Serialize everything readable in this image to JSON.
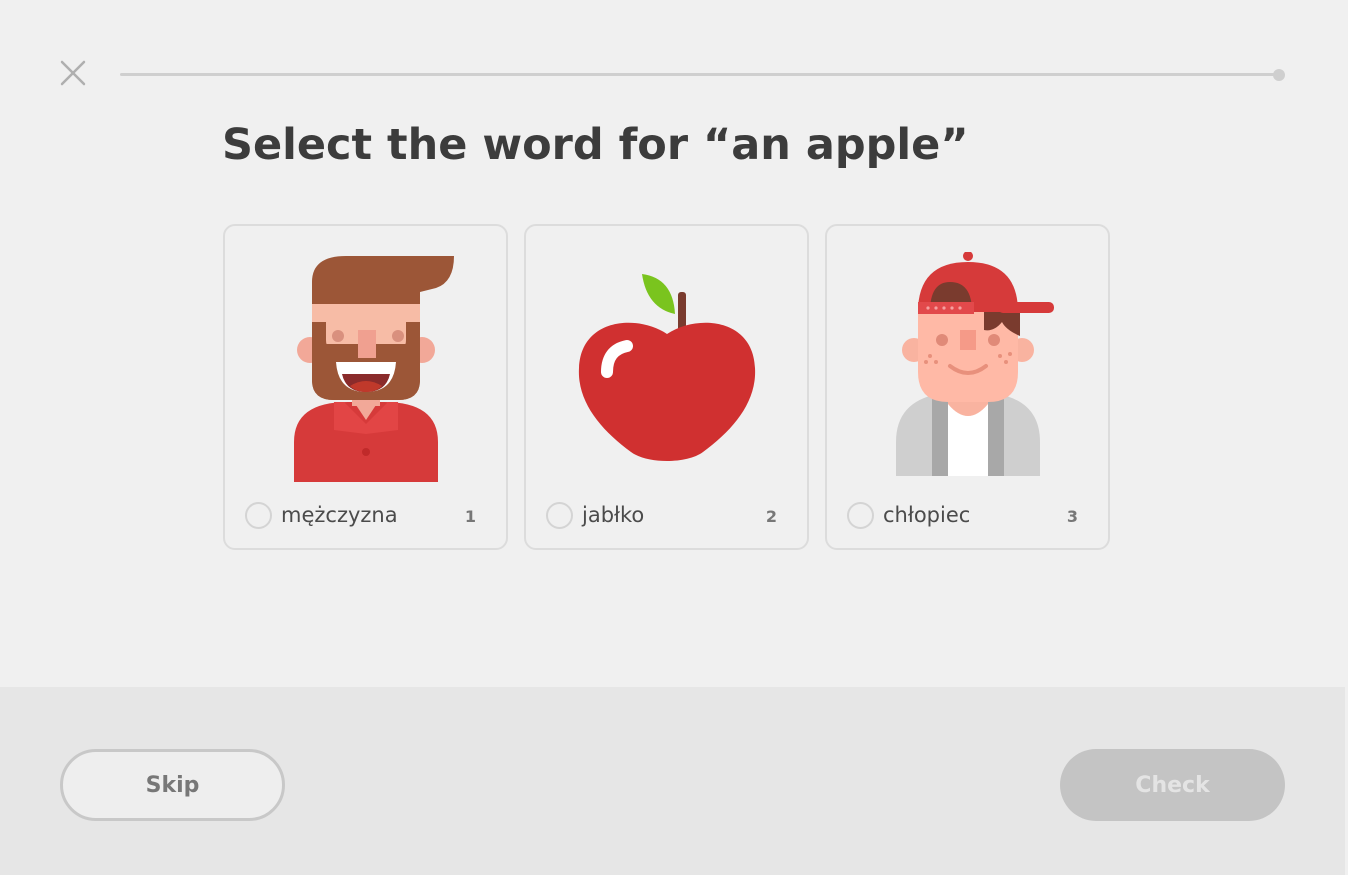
{
  "header": {
    "close_icon": "close-icon",
    "progress_percent": 0
  },
  "prompt": {
    "title": "Select the word for “an apple”"
  },
  "choices": [
    {
      "word": "mężczyzna",
      "key": "1",
      "icon": "man-illustration"
    },
    {
      "word": "jabłko",
      "key": "2",
      "icon": "apple-illustration"
    },
    {
      "word": "chłopiec",
      "key": "3",
      "icon": "boy-illustration"
    }
  ],
  "footer": {
    "skip_label": "Skip",
    "check_label": "Check"
  },
  "colors": {
    "background": "#f0f0f0",
    "footer_bg": "#e6e6e6",
    "card_border": "#dcdcdc",
    "check_disabled": "#c4c4c4",
    "apple_red": "#d03030"
  }
}
